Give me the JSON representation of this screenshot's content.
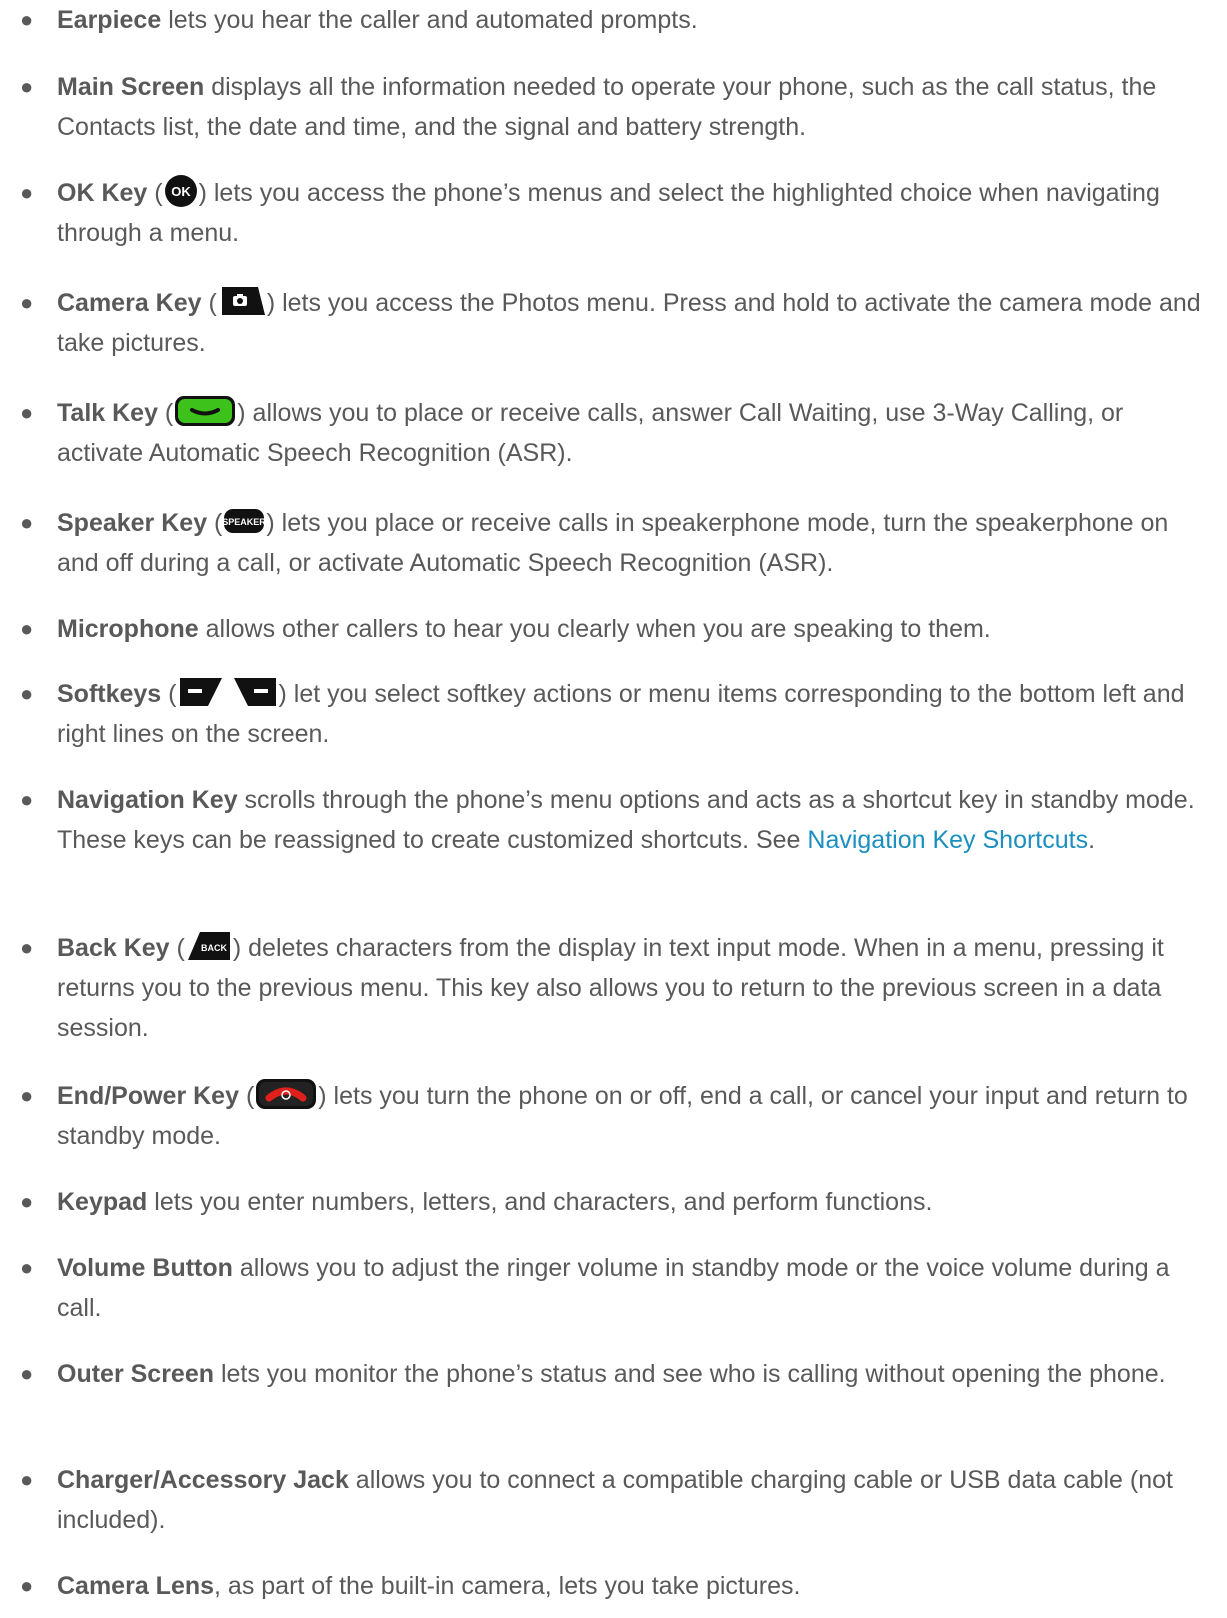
{
  "items": [
    {
      "term": "Earpiece",
      "desc": " lets you hear the caller and automated prompts."
    },
    {
      "term": "Main Screen",
      "desc": " displays all the information needed to operate your phone, such as the call status, the Contacts list, the date and time, and the signal and battery strength."
    },
    {
      "term": "OK Key",
      "icon": "ok-key-icon",
      "icon_label": "OK",
      "desc": " lets you access the phone’s menus and select the highlighted choice when navigating through a menu."
    },
    {
      "term": "Camera Key",
      "icon": "camera-key-icon",
      "desc": " lets you access the Photos menu. Press and hold to activate the camera mode and take pictures."
    },
    {
      "term": "Talk Key",
      "icon": "talk-key-icon",
      "desc": " allows you to place or receive calls, answer Call Waiting, use 3-Way Calling, or activate Automatic Speech Recognition (ASR)."
    },
    {
      "term": "Speaker Key",
      "icon": "speaker-key-icon",
      "icon_label": "SPEAKER",
      "desc": " lets you place or receive calls in speakerphone mode, turn the speakerphone on and off during a call, or activate Automatic Speech Recognition (ASR)."
    },
    {
      "term": "Microphone",
      "desc": " allows other callers to hear you clearly when you are speaking to them."
    },
    {
      "term": "Softkeys",
      "icon": "softkeys-icon",
      "desc": " let you select softkey actions or menu items corresponding to the bottom left and right lines on the screen."
    },
    {
      "term": "Navigation Key",
      "desc": " scrolls through the phone’s menu options and acts as a shortcut key in standby mode. These keys can be reassigned to create customized shortcuts. See ",
      "link": "Navigation Key Shortcuts",
      "after": "."
    },
    {
      "term": "Back Key",
      "icon": "back-key-icon",
      "icon_label": "BACK",
      "desc": " deletes characters from the display in text input mode. When in a menu, pressing it returns you to the previous menu. This key also allows you to return to the previous screen in a data session."
    },
    {
      "term": "End/Power Key",
      "icon": "end-power-key-icon",
      "desc": " lets you turn the phone on or off, end a call, or cancel your input and return to standby mode."
    },
    {
      "term": "Keypad",
      "desc": " lets you enter numbers, letters, and characters, and perform functions."
    },
    {
      "term": "Volume Button",
      "desc": " allows you to adjust the ringer volume in standby mode or the voice volume during a call."
    },
    {
      "term": "Outer Screen",
      "desc": " lets you monitor the phone’s status and see who is calling without opening the phone."
    },
    {
      "term": "Charger/Accessory Jack",
      "desc": " allows you to connect a compatible charging cable or USB data cable (not included)."
    },
    {
      "term": "Camera Lens",
      "desc": ", as part of the built-in camera, lets you take pictures."
    }
  ],
  "bullet_glyph": "●",
  "colors": {
    "text": "#595959",
    "link": "#1b8fc0",
    "key_dark": "#111111",
    "talk_green": "#3cc21a",
    "end_red": "#e0201c"
  }
}
